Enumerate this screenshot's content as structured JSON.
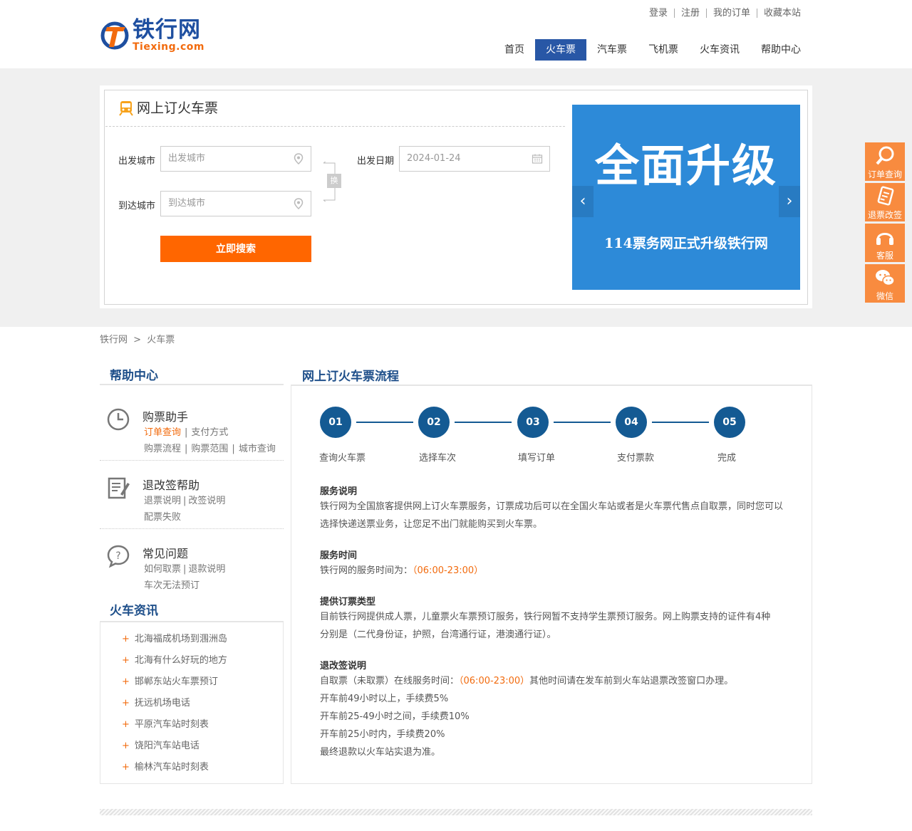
{
  "header": {
    "logo_cn": "铁行网",
    "logo_en": "Tiexing.com",
    "top_links": [
      "登录",
      "注册",
      "我的订单",
      "收藏本站"
    ],
    "nav": [
      {
        "label": "首页",
        "active": false
      },
      {
        "label": "火车票",
        "active": true
      },
      {
        "label": "汽车票",
        "active": false
      },
      {
        "label": "飞机票",
        "active": false
      },
      {
        "label": "火车资讯",
        "active": false
      },
      {
        "label": "帮助中心",
        "active": false
      }
    ]
  },
  "search": {
    "title": "网上订火车票",
    "depart_label": "出发城市",
    "depart_placeholder": "出发城市",
    "arrive_label": "到达城市",
    "arrive_placeholder": "到达城市",
    "date_label": "出发日期",
    "date_value": "2024-01-24",
    "swap_label": "换",
    "search_button": "立即搜索"
  },
  "banner": {
    "headline": "全面升级",
    "subline": "114票务网正式升级铁行网"
  },
  "side_float": [
    {
      "label": "订单查询",
      "icon": "search-icon"
    },
    {
      "label": "退票改签",
      "icon": "ticket-icon"
    },
    {
      "label": "客服",
      "icon": "headset-icon"
    },
    {
      "label": "微信",
      "icon": "wechat-icon"
    }
  ],
  "breadcrumb": {
    "home": "铁行网",
    "sep": ">",
    "current": "火车票"
  },
  "help": {
    "title": "帮助中心",
    "groups": [
      {
        "name": "购票助手",
        "links": [
          "订单查询",
          "支付方式",
          "购票流程",
          "购票范围",
          "城市查询"
        ]
      },
      {
        "name": "退改签帮助",
        "links": [
          "退票说明",
          "改签说明",
          "配票失败"
        ]
      },
      {
        "name": "常见问题",
        "links": [
          "如何取票",
          "退款说明",
          "车次无法预订"
        ]
      }
    ]
  },
  "news": {
    "title": "火车资讯",
    "items": [
      "北海福成机场到涠洲岛",
      "北海有什么好玩的地方",
      "邯郸东站火车票预订",
      "抚远机场电话",
      "平原汽车站时刻表",
      "饶阳汽车站电话",
      "榆林汽车站时刻表"
    ]
  },
  "process": {
    "title": "网上订火车票流程",
    "steps": [
      {
        "num": "01",
        "label": "查询火车票"
      },
      {
        "num": "02",
        "label": "选择车次"
      },
      {
        "num": "03",
        "label": "填写订单"
      },
      {
        "num": "04",
        "label": "支付票款"
      },
      {
        "num": "05",
        "label": "完成"
      }
    ]
  },
  "sections": {
    "service_title": "服务说明",
    "service_text": "铁行网为全国旅客提供网上订火车票服务，订票成功后可以在全国火车站或者是火车票代售点自取票，同时您可以选择快递送票业务，让您足不出门就能购买到火车票。",
    "time_title": "服务时间",
    "time_text": "铁行网的服务时间为：",
    "time_value": "（06:00-23:00）",
    "type_title": "提供订票类型",
    "type_text": "目前铁行网提供成人票，儿童票火车票预订服务，铁行网暂不支持学生票预订服务。网上购票支持的证件有4种分别是（二代身份证，护照，台湾通行证，港澳通行证）。",
    "refund_title": "退改签说明",
    "refund_prefix": "自取票（未取票）在线服务时间：",
    "refund_time": "（06:00-23:00）",
    "refund_suffix": "其他时间请在发车前到火车站退票改签窗口办理。",
    "refund_lines": [
      "开车前49小时以上，手续费5%",
      "开车前25-49小时之间，手续费10%",
      "开车前25小时内，手续费20%",
      "最终退款以火车站实退为准。"
    ]
  },
  "colors": {
    "brand_blue": "#2857a6",
    "accent_orange": "#ff6600",
    "step_blue": "#145a93",
    "float_orange": "#f88b3f",
    "banner_blue": "#2d8ad8"
  }
}
